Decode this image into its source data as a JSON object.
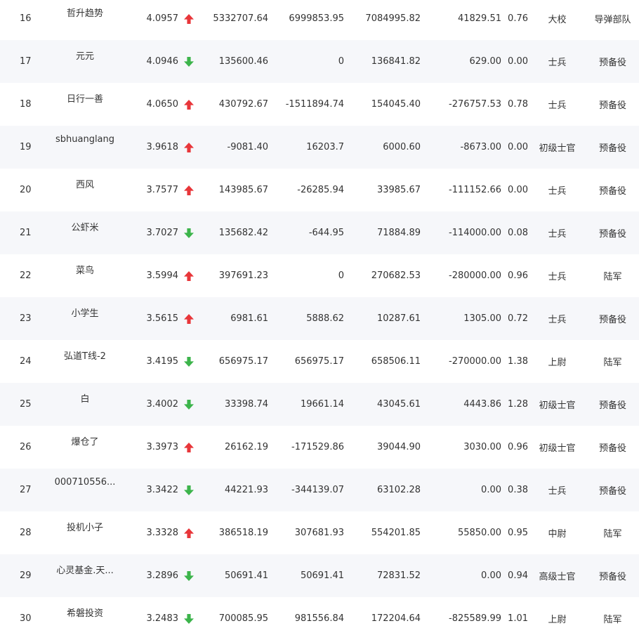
{
  "colors": {
    "up": "#e8363a",
    "down": "#3cb44b",
    "row_alt": "#f6f7fa",
    "text": "#333333"
  },
  "icons": {
    "up": "arrow-up-icon",
    "down": "arrow-down-icon"
  },
  "rows": [
    {
      "rank": "16",
      "name": "哲升趋势",
      "score": "4.0957",
      "trend": "up",
      "v1": "5332707.64",
      "v2": "6999853.95",
      "v3": "7084995.82",
      "v4": "41829.51",
      "rate": "0.76",
      "title": "大校",
      "branch": "导弹部队"
    },
    {
      "rank": "17",
      "name": "元元",
      "score": "4.0946",
      "trend": "down",
      "v1": "135600.46",
      "v2": "0",
      "v3": "136841.82",
      "v4": "629.00",
      "rate": "0.00",
      "title": "士兵",
      "branch": "预备役"
    },
    {
      "rank": "18",
      "name": "日行一善",
      "score": "4.0650",
      "trend": "up",
      "v1": "430792.67",
      "v2": "-1511894.74",
      "v3": "154045.40",
      "v4": "-276757.53",
      "rate": "0.78",
      "title": "士兵",
      "branch": "预备役"
    },
    {
      "rank": "19",
      "name": "sbhuanglang",
      "score": "3.9618",
      "trend": "up",
      "v1": "-9081.40",
      "v2": "16203.7",
      "v3": "6000.60",
      "v4": "-8673.00",
      "rate": "0.00",
      "title": "初级士官",
      "branch": "预备役"
    },
    {
      "rank": "20",
      "name": "西风",
      "score": "3.7577",
      "trend": "up",
      "v1": "143985.67",
      "v2": "-26285.94",
      "v3": "33985.67",
      "v4": "-111152.66",
      "rate": "0.00",
      "title": "士兵",
      "branch": "预备役"
    },
    {
      "rank": "21",
      "name": "公虾米",
      "score": "3.7027",
      "trend": "down",
      "v1": "135682.42",
      "v2": "-644.95",
      "v3": "71884.89",
      "v4": "-114000.00",
      "rate": "0.08",
      "title": "士兵",
      "branch": "预备役"
    },
    {
      "rank": "22",
      "name": "菜鸟",
      "score": "3.5994",
      "trend": "up",
      "v1": "397691.23",
      "v2": "0",
      "v3": "270682.53",
      "v4": "-280000.00",
      "rate": "0.96",
      "title": "士兵",
      "branch": "陆军"
    },
    {
      "rank": "23",
      "name": "小学生",
      "score": "3.5615",
      "trend": "up",
      "v1": "6981.61",
      "v2": "5888.62",
      "v3": "10287.61",
      "v4": "1305.00",
      "rate": "0.72",
      "title": "士兵",
      "branch": "预备役"
    },
    {
      "rank": "24",
      "name": "弘道T线-2",
      "score": "3.4195",
      "trend": "down",
      "v1": "656975.17",
      "v2": "656975.17",
      "v3": "658506.11",
      "v4": "-270000.00",
      "rate": "1.38",
      "title": "上尉",
      "branch": "陆军"
    },
    {
      "rank": "25",
      "name": "白",
      "score": "3.4002",
      "trend": "down",
      "v1": "33398.74",
      "v2": "19661.14",
      "v3": "43045.61",
      "v4": "4443.86",
      "rate": "1.28",
      "title": "初级士官",
      "branch": "预备役"
    },
    {
      "rank": "26",
      "name": "爆仓了",
      "score": "3.3973",
      "trend": "up",
      "v1": "26162.19",
      "v2": "-171529.86",
      "v3": "39044.90",
      "v4": "3030.00",
      "rate": "0.96",
      "title": "初级士官",
      "branch": "预备役"
    },
    {
      "rank": "27",
      "name": "000710556...",
      "score": "3.3422",
      "trend": "down",
      "v1": "44221.93",
      "v2": "-344139.07",
      "v3": "63102.28",
      "v4": "0.00",
      "rate": "0.38",
      "title": "士兵",
      "branch": "预备役"
    },
    {
      "rank": "28",
      "name": "投机小子",
      "score": "3.3328",
      "trend": "up",
      "v1": "386518.19",
      "v2": "307681.93",
      "v3": "554201.85",
      "v4": "55850.00",
      "rate": "0.95",
      "title": "中尉",
      "branch": "陆军"
    },
    {
      "rank": "29",
      "name": "心灵基金.天...",
      "score": "3.2896",
      "trend": "down",
      "v1": "50691.41",
      "v2": "50691.41",
      "v3": "72831.52",
      "v4": "0.00",
      "rate": "0.94",
      "title": "高级士官",
      "branch": "预备役"
    },
    {
      "rank": "30",
      "name": "希磐投资",
      "score": "3.2483",
      "trend": "down",
      "v1": "700085.95",
      "v2": "981556.84",
      "v3": "172204.64",
      "v4": "-825589.99",
      "rate": "1.01",
      "title": "上尉",
      "branch": "陆军"
    }
  ]
}
